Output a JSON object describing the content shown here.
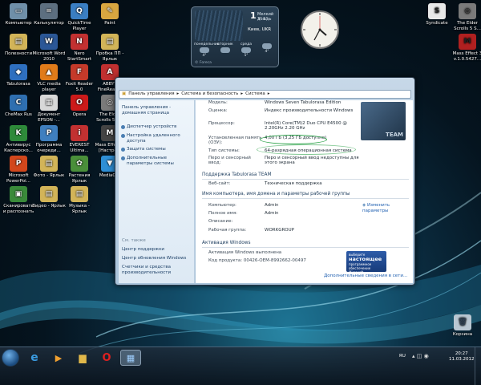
{
  "desktop": {
    "icons": [
      {
        "label": "Компьютер",
        "color": "#6f8fa8",
        "glyph": "▭"
      },
      {
        "label": "Калькулятор",
        "color": "#5d6f80",
        "glyph": "="
      },
      {
        "label": "QuickTime Player",
        "color": "#3a7ec2",
        "glyph": "Q"
      },
      {
        "label": "Paint",
        "color": "#d9a640",
        "glyph": "✎"
      },
      {
        "label": "Полезности",
        "color": "#d2b458",
        "glyph": "▤"
      },
      {
        "label": "Microsoft Word 2010",
        "color": "#2b5797",
        "glyph": "W"
      },
      {
        "label": "Nero StartSmart",
        "color": "#c23131",
        "glyph": "N"
      },
      {
        "label": "Пробка ПП - Ярлык",
        "color": "#d2b458",
        "glyph": "▤"
      },
      {
        "label": "Tabulorasa",
        "color": "#2e6fbf",
        "glyph": "◆"
      },
      {
        "label": "VLC media player",
        "color": "#e07b1a",
        "glyph": "▲"
      },
      {
        "label": "Foxit Reader 5.0",
        "color": "#c43a2a",
        "glyph": "F"
      },
      {
        "label": "ABBYY FineRead...",
        "color": "#c03030",
        "glyph": "A"
      },
      {
        "label": "CheMax Rus",
        "color": "#2f6fb0",
        "glyph": "C"
      },
      {
        "label": "Документ EPSON -...",
        "color": "#d8d8d8",
        "glyph": "▦"
      },
      {
        "label": "Opera",
        "color": "#cc1a1a",
        "glyph": "O"
      },
      {
        "label": "The Elder Scrolls 5 S...",
        "color": "#7a7a7a",
        "glyph": "◎"
      },
      {
        "label": "Антивирус Касперско...",
        "color": "#2e8a3a",
        "glyph": "K"
      },
      {
        "label": "Программа очереди...",
        "color": "#3f7fbf",
        "glyph": "P"
      },
      {
        "label": "EVEREST Ultima...",
        "color": "#c23131",
        "glyph": "i"
      },
      {
        "label": "Mass Effect 3 [Настро...",
        "color": "#444",
        "glyph": "M"
      },
      {
        "label": "Microsoft PowerPoi...",
        "color": "#d2471c",
        "glyph": "P"
      },
      {
        "label": "Фото - Ярлык",
        "color": "#d2b458",
        "glyph": "▤"
      },
      {
        "label": "Растения Ярлык",
        "color": "#4a8f3a",
        "glyph": "✿"
      },
      {
        "label": "MediaGet",
        "color": "#2e8fd6",
        "glyph": "▼"
      },
      {
        "label": "Сканировать и распознать",
        "color": "#3a8a3a",
        "glyph": "▣"
      },
      {
        "label": "Видео - Ярлык",
        "color": "#d2b458",
        "glyph": "▤"
      },
      {
        "label": "Музыка - Ярлык",
        "color": "#d2b458",
        "glyph": "▤"
      }
    ],
    "right_icons": [
      {
        "label": "Syndicate",
        "color": "#e8e8e8",
        "glyph": "S"
      },
      {
        "label": "The Elder Scrolls 5 S...",
        "color": "#7a7a7a",
        "glyph": "◎"
      },
      {
        "label": "Mass Effect 3 v.1.0.5427...",
        "color": "#b02020",
        "glyph": "M"
      }
    ],
    "recycle_bin": "Корзина"
  },
  "weather": {
    "temp": "1",
    "condition": "Мелкий дождь",
    "range": "3° 1°",
    "city": "Киев, UKR",
    "days": [
      {
        "name": "понедельник",
        "temp": "4°"
      },
      {
        "name": "вторник",
        "temp": ""
      },
      {
        "name": "среда",
        "temp": "5°"
      },
      {
        "name": "",
        "temp": "4°"
      }
    ],
    "source": "© Foreca"
  },
  "window": {
    "address": [
      "Панель управления",
      "Система и безопасность",
      "Система"
    ],
    "left_links": [
      "Панель управления - домашняя страница"
    ],
    "tasks": [
      "Диспетчер устройств",
      "Настройка удаленного доступа",
      "Защита системы",
      "Дополнительные параметры системы"
    ],
    "see_also_head": "См. также",
    "see_also": [
      "Центр поддержки",
      "Центр обновления Windows",
      "Счетчики и средства производительности"
    ],
    "rows": [
      {
        "k": "Модель:",
        "v": "Windows Seven Tabulorasa Edition"
      },
      {
        "k": "Оценка:",
        "v": "Индекс производительности Windows"
      },
      {
        "k": "Процессор:",
        "v": "Intel(R) Core(TM)2 Duo CPU     E4500  @ 2.20GHz   2.20 GHz"
      },
      {
        "k": "Установленная память (ОЗУ):",
        "v": "4,00 ГБ (3,25 ГБ доступно)"
      },
      {
        "k": "Тип системы:",
        "v": "64-разрядная операционная система"
      },
      {
        "k": "Перо и сенсорный ввод:",
        "v": "Перо и сенсорный ввод недоступны для этого экрана"
      }
    ],
    "support_head": "Поддержка Tabulorasa TEAM",
    "support_row": {
      "k": "Веб-сайт:",
      "v": "Техническая поддержка"
    },
    "computer_head": "Имя компьютера, имя домена и параметры рабочей группы",
    "computer_rows": [
      {
        "k": "Компьютер:",
        "v": "Admin"
      },
      {
        "k": "Полное имя:",
        "v": "Admin"
      },
      {
        "k": "Описание:",
        "v": ""
      },
      {
        "k": "Рабочая группа:",
        "v": "WORKGROUP"
      }
    ],
    "change_settings": "Изменить параметры",
    "activation_head": "Активация Windows",
    "activation_rows": [
      {
        "k": "Активация Windows выполнена",
        "v": ""
      },
      {
        "k": "Код продукта: 00426-OEM-8992662-00497",
        "v": ""
      }
    ],
    "more_online": "Дополнительные сведения в сети...",
    "team_logo": "TEAM",
    "genuine": {
      "line1": "выберите",
      "line2": "настоящее",
      "line3": "программное обеспечение",
      "line4": "Microsoft"
    }
  },
  "taskbar": {
    "lang": "RU",
    "time": "20:27",
    "date": "11.03.2012"
  }
}
